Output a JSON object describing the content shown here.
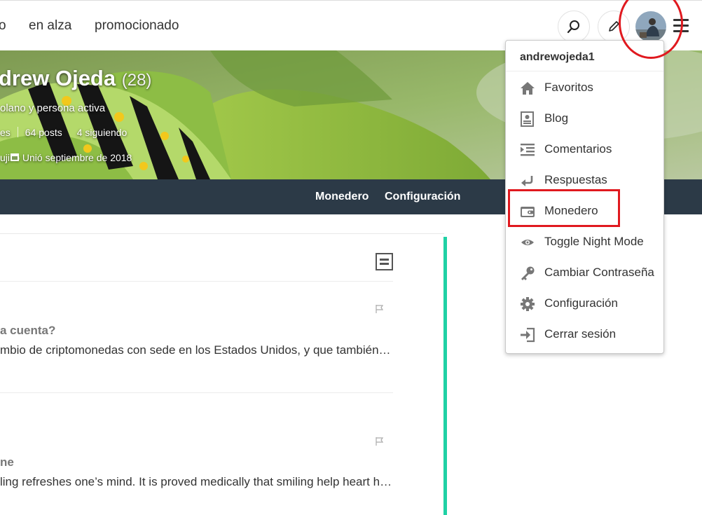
{
  "nav": {
    "links": [
      "o",
      "en alza",
      "promocionado"
    ],
    "search_icon": "search-icon",
    "compose_icon": "pencil-icon",
    "menu_icon": "hamburger-icon"
  },
  "profile": {
    "name": "drew Ojeda",
    "reputation": "(28)",
    "about": "olano y persona activa",
    "stats": [
      "es",
      "64 posts",
      "4 siguiendo"
    ],
    "location": "ujillo",
    "joined": "Unió septiembre de 2018"
  },
  "subnav": {
    "links": [
      "Monedero",
      "Configuración"
    ]
  },
  "feed": {
    "posts": [
      {
        "title": "a cuenta?",
        "body": "mbio de criptomonedas con sede en los Estados Unidos, y que también ofrece billeteras"
      },
      {
        "title": "ne",
        "body": "ling refreshes one’s mind. It is proved medically that smiling help heart health"
      }
    ]
  },
  "menu": {
    "username": "andrewojeda1",
    "items": [
      {
        "label": "Favoritos",
        "icon": "home-icon"
      },
      {
        "label": "Blog",
        "icon": "blog-icon"
      },
      {
        "label": "Comentarios",
        "icon": "comments-icon"
      },
      {
        "label": "Respuestas",
        "icon": "reply-icon"
      },
      {
        "label": "Monedero",
        "icon": "wallet-icon"
      },
      {
        "label": "Toggle Night Mode",
        "icon": "eye-icon"
      },
      {
        "label": "Cambiar Contraseña",
        "icon": "key-icon"
      },
      {
        "label": "Configuración",
        "icon": "gear-icon"
      },
      {
        "label": "Cerrar sesión",
        "icon": "logout-icon"
      }
    ]
  },
  "colors": {
    "accent": "#1fd1a5",
    "subbar": "#2c3a47",
    "highlight": "#e0191f"
  }
}
